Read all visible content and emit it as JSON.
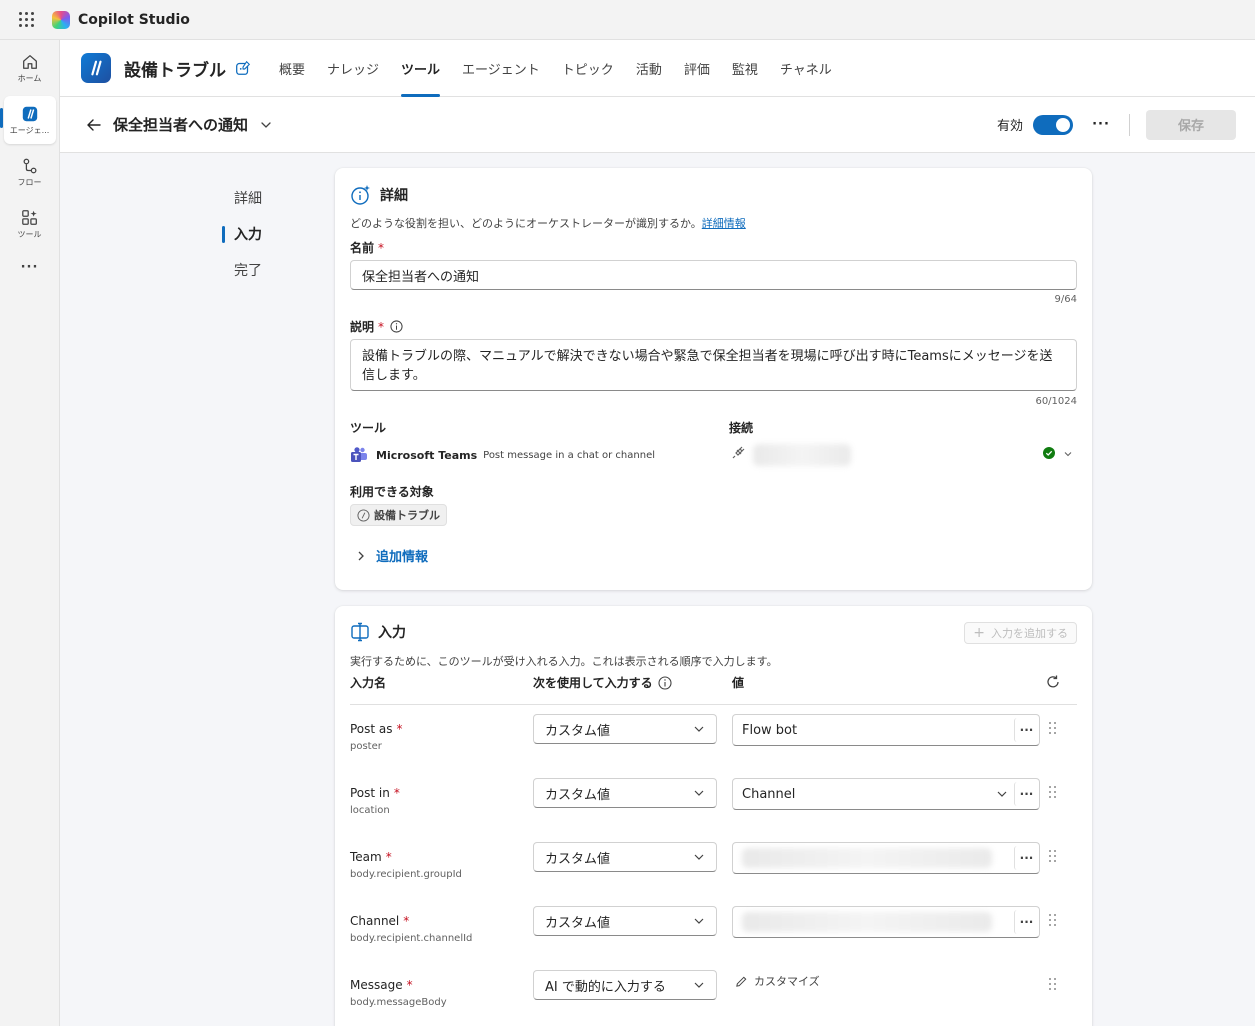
{
  "app": {
    "name": "Copilot Studio"
  },
  "rail": [
    {
      "label": "ホーム",
      "icon": "home-icon"
    },
    {
      "label": "エージェ...",
      "icon": "agent-icon"
    },
    {
      "label": "フロー",
      "icon": "flow-icon"
    },
    {
      "label": "ツール",
      "icon": "tools-icon"
    }
  ],
  "agent": {
    "name": "設備トラブル"
  },
  "tabs": [
    "概要",
    "ナレッジ",
    "ツール",
    "エージェント",
    "トピック",
    "活動",
    "評価",
    "監視",
    "チャネル"
  ],
  "toolbar": {
    "title": "保全担当者への通知",
    "enabled_label": "有効",
    "save_label": "保存"
  },
  "sidenav": [
    "詳細",
    "入力",
    "完了"
  ],
  "details": {
    "title": "詳細",
    "description": "どのような役割を担い、どのようにオーケストレーターが識別するか。",
    "learn_more": "詳細情報",
    "name_label": "名前",
    "name_value": "保全担当者への通知",
    "name_count": "9/64",
    "desc_label": "説明",
    "desc_value": "設備トラブルの際、マニュアルで解決できない場合や緊急で保全担当者を現場に呼び出す時にTeamsにメッセージを送信します。",
    "desc_count": "60/1024",
    "tool_label": "ツール",
    "tool_name": "Microsoft Teams",
    "tool_action": "Post message in a chat or channel",
    "connection_label": "接続",
    "available_label": "利用できる対象",
    "available_chip": "設備トラブル",
    "more_info": "追加情報"
  },
  "inputs": {
    "title": "入力",
    "add_button": "入力を追加する",
    "description": "実行するために、このツールが受け入れる入力。これは表示される順序で入力します。",
    "col_name": "入力名",
    "col_fill": "次を使用して入力する",
    "col_value": "値",
    "rows": [
      {
        "name": "Post as",
        "sub": "poster",
        "mode": "カスタム値",
        "value": "Flow bot",
        "dropdown": false
      },
      {
        "name": "Post in",
        "sub": "location",
        "mode": "カスタム値",
        "value": "Channel",
        "dropdown": true
      },
      {
        "name": "Team",
        "sub": "body.recipient.groupId",
        "mode": "カスタム値",
        "value": "",
        "dropdown": false
      },
      {
        "name": "Channel",
        "sub": "body.recipient.channelId",
        "mode": "カスタム値",
        "value": "",
        "dropdown": false
      }
    ],
    "message_row": {
      "name": "Message",
      "sub": "body.messageBody",
      "mode": "AI で動的に入力する",
      "customize": "カスタマイズ"
    }
  },
  "colors": {
    "accent": "#0f6cbd",
    "required": "#c50f1f",
    "success": "#107c10"
  }
}
